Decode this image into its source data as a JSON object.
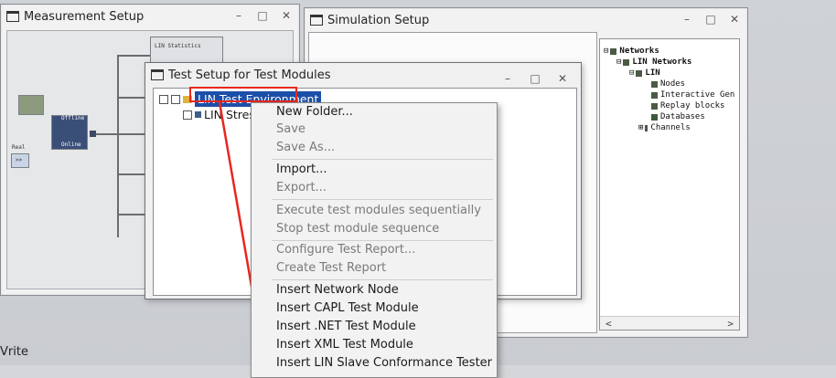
{
  "measurement_window": {
    "title": "Measurement Setup",
    "nodes": {
      "lin_statistics": "LIN Statistics",
      "offline": "Offline",
      "online": "Online",
      "real": "Real",
      "forward": ">>"
    }
  },
  "simulation_window": {
    "title": "Simulation Setup"
  },
  "window_controls": {
    "minimize": "–",
    "maximize": "□",
    "close": "✕"
  },
  "network_tree": {
    "items": [
      {
        "label": "Networks",
        "toggle": "⊟"
      },
      {
        "label": "LIN Networks",
        "toggle": "⊟"
      },
      {
        "label": "LIN",
        "toggle": "⊟"
      },
      {
        "label": "Nodes",
        "toggle": ""
      },
      {
        "label": "Interactive Gen",
        "toggle": ""
      },
      {
        "label": "Replay blocks",
        "toggle": ""
      },
      {
        "label": "Databases",
        "toggle": ""
      },
      {
        "label": "Channels",
        "toggle": "⊞"
      }
    ],
    "scroll_left": "<",
    "scroll_right": ">"
  },
  "test_window": {
    "title": "Test Setup for Test Modules",
    "tree": {
      "root": "LIN Test Environment",
      "child": "LIN Stress"
    }
  },
  "context_menu": {
    "items": [
      {
        "label": "New Folder...",
        "enabled": true
      },
      {
        "label": "Save",
        "enabled": false
      },
      {
        "label": "Save As...",
        "enabled": false
      },
      {
        "label": "Import...",
        "enabled": true
      },
      {
        "label": "Export...",
        "enabled": false
      },
      {
        "label": "Execute test modules sequentially",
        "enabled": false
      },
      {
        "label": "Stop test module sequence",
        "enabled": false
      },
      {
        "label": "Configure Test Report...",
        "enabled": false
      },
      {
        "label": "Create Test Report",
        "enabled": false
      },
      {
        "label": "Insert Network Node",
        "enabled": true
      },
      {
        "label": "Insert CAPL Test Module",
        "enabled": true
      },
      {
        "label": "Insert .NET Test Module",
        "enabled": true
      },
      {
        "label": "Insert XML Test Module",
        "enabled": true
      },
      {
        "label": "Insert LIN Slave Conformance Tester",
        "enabled": true
      }
    ]
  },
  "status_bar": {
    "text": "Vrite"
  },
  "colors": {
    "highlight": "#1c4fa8",
    "annotation_red": "#e8271f"
  }
}
